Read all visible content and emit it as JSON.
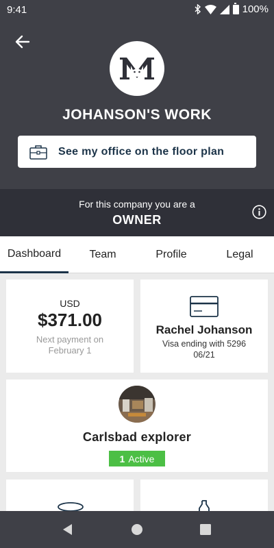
{
  "status_bar": {
    "time": "9:41",
    "battery": "100%"
  },
  "header": {
    "company_name": "JOHANSON'S WORK",
    "floor_plan_button": "See my office on the floor plan"
  },
  "role": {
    "prefix": "For this company you are a",
    "value": "OWNER"
  },
  "tabs": [
    {
      "label": "Dashboard",
      "active": true
    },
    {
      "label": "Team"
    },
    {
      "label": "Profile"
    },
    {
      "label": "Legal"
    }
  ],
  "payment": {
    "currency": "USD",
    "amount": "$371.00",
    "next_line1": "Next payment on",
    "next_line2": "February 1"
  },
  "card": {
    "holder": "Rachel Johanson",
    "ending": "Visa ending with 5296",
    "expiry": "06/21"
  },
  "plan": {
    "name": "Carlsbad explorer",
    "active_count": "1",
    "active_label": "Active"
  },
  "colors": {
    "header_bg": "#3f4047",
    "role_bg": "#2f3038",
    "accent_navy": "#1b3348",
    "active_green": "#4cbf45"
  }
}
